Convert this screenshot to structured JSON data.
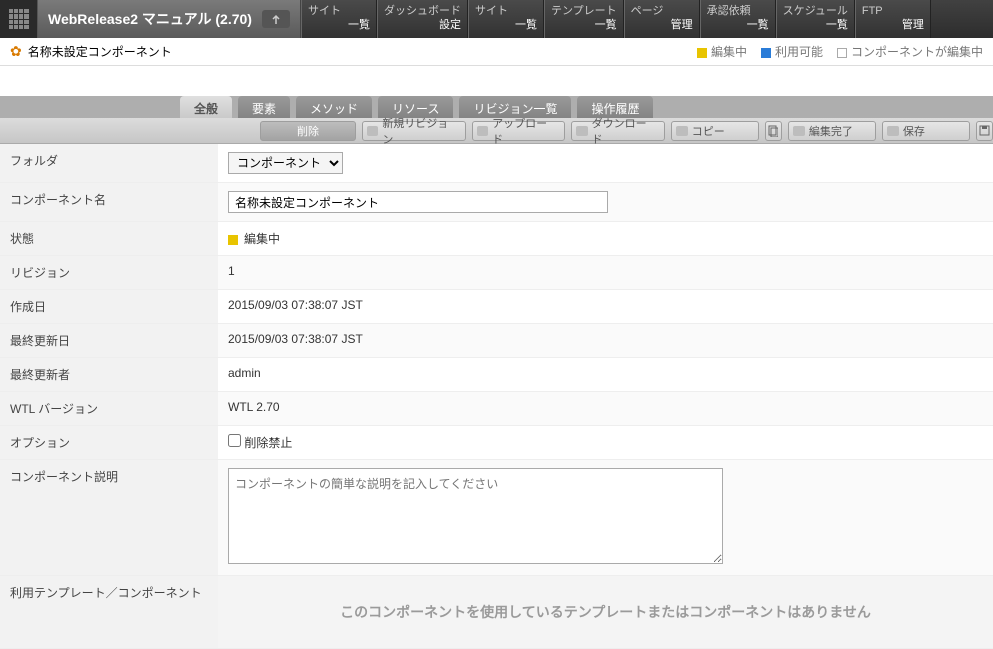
{
  "header": {
    "title": "WebRelease2 マニュアル (2.70)",
    "nav": [
      {
        "label": "サイト",
        "sub": "一覧"
      },
      {
        "label": "ダッシュボード",
        "sub": "設定"
      },
      {
        "label": "サイト",
        "sub": "一覧"
      },
      {
        "label": "テンプレート",
        "sub": "一覧"
      },
      {
        "label": "ページ",
        "sub": "管理"
      },
      {
        "label": "承認依頼",
        "sub": "一覧"
      },
      {
        "label": "スケジュール",
        "sub": "一覧"
      },
      {
        "label": "FTP",
        "sub": "管理"
      }
    ]
  },
  "subheader": {
    "title": "名称未設定コンポーネント",
    "legend": {
      "editing": "編集中",
      "available": "利用可能",
      "component_editing": "コンポーネントが編集中"
    }
  },
  "tabs": {
    "items": [
      "全般",
      "要素",
      "メソッド",
      "リソース",
      "リビジョン一覧",
      "操作履歴"
    ],
    "active_index": 0
  },
  "toolbar": {
    "delete": "削除",
    "new_revision": "新規リビジョン",
    "upload": "アップロード",
    "download": "ダウンロード",
    "copy": "コピー",
    "finish_edit": "編集完了",
    "save": "保存"
  },
  "form": {
    "labels": {
      "folder": "フォルダ",
      "component_name": "コンポーネント名",
      "status": "状態",
      "revision": "リビジョン",
      "created": "作成日",
      "updated": "最終更新日",
      "updater": "最終更新者",
      "wtl_version": "WTL バージョン",
      "options": "オプション",
      "description": "コンポーネント説明",
      "usage": "利用テンプレート／コンポーネント"
    },
    "values": {
      "folder_option": "コンポーネント",
      "component_name": "名称未設定コンポーネント",
      "status": "編集中",
      "revision": "1",
      "created": "2015/09/03 07:38:07 JST",
      "updated": "2015/09/03 07:38:07 JST",
      "updater": "admin",
      "wtl_version": "WTL 2.70",
      "option_delete_prohibit": "削除禁止",
      "description_placeholder": "コンポーネントの簡単な説明を記入してください",
      "no_usage_message": "このコンポーネントを使用しているテンプレートまたはコンポーネントはありません"
    }
  }
}
